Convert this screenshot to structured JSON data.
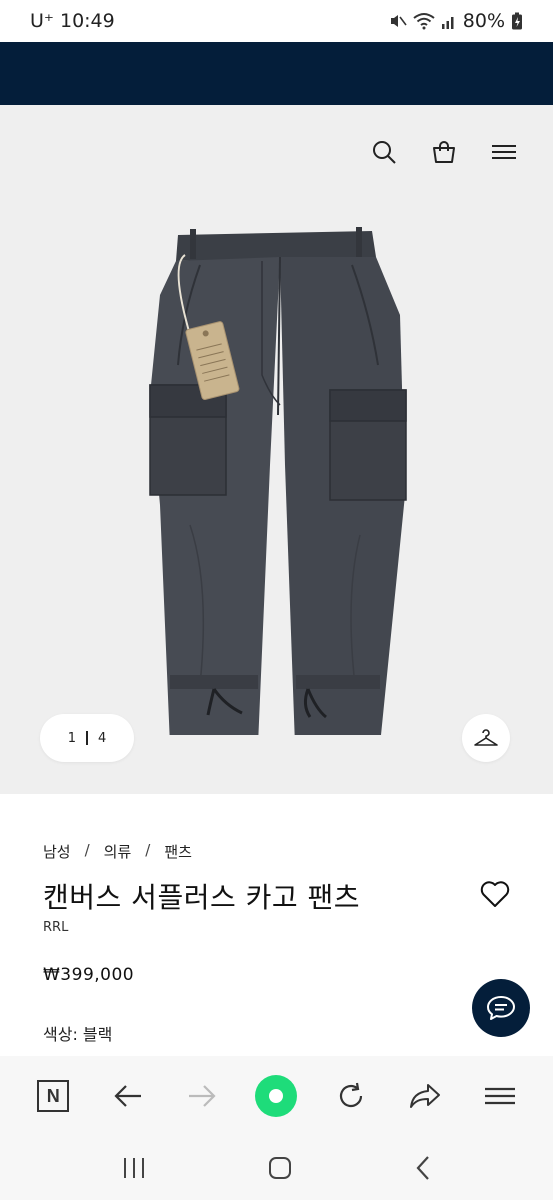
{
  "status_bar": {
    "carrier_time": "U⁺ 10:49",
    "battery": "80%"
  },
  "hero": {
    "pager_current": "1",
    "pager_total": "4"
  },
  "product": {
    "breadcrumb": [
      "남성",
      "의류",
      "팬츠"
    ],
    "breadcrumb_separator": "/",
    "title": "캔버스 서플러스 카고 팬츠",
    "brand": "RRL",
    "price": "₩399,000",
    "color_label": "색상: 블랙"
  },
  "toolbar": {
    "n_logo": "N"
  },
  "colors": {
    "navy": "#041e3a",
    "hero_bg": "#efefef",
    "toolbar_green": "#1edc7a"
  }
}
